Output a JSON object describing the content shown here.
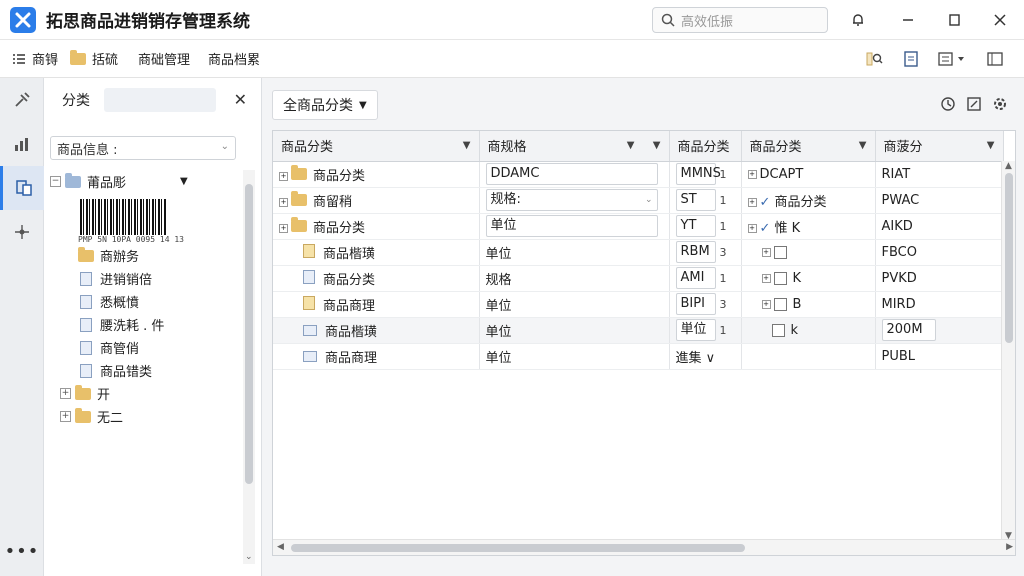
{
  "app": {
    "title": "拓思商品进销销存管理系统"
  },
  "search": {
    "placeholder": "高效低振"
  },
  "menu": {
    "items": [
      "商锝",
      "括硫",
      "商础管理",
      "商品档累"
    ]
  },
  "category_panel": {
    "title": "分类",
    "select_value": "商品信息 :",
    "tree": [
      {
        "label": "莆品彫",
        "level": 0
      },
      {
        "label": "商辦务",
        "level": 1
      },
      {
        "label": "进销销倍",
        "level": 1
      },
      {
        "label": "悉概憤",
        "level": 1
      },
      {
        "label": "腰洗耗 . 件",
        "level": 1
      },
      {
        "label": "商管俏",
        "level": 1
      },
      {
        "label": "商品错类",
        "level": 1
      },
      {
        "label": "开",
        "level": 0
      },
      {
        "label": "无二",
        "level": 0
      }
    ],
    "barcode_text": "PMP 5N 10PA 0095 14 13"
  },
  "main": {
    "tab_label": "全商品分类",
    "columns": [
      "商品分类",
      "商规格",
      "商品分类",
      "商品分类",
      "商菠分"
    ],
    "rows": [
      {
        "c1": "商品分类",
        "c2": "DDAMC",
        "c3": "MMNS",
        "c3n": "1",
        "c4": "DCAPT",
        "c5": "RIAT"
      },
      {
        "c1": "商留稍",
        "c2": "规格:",
        "c3": "ST",
        "c3n": "1",
        "c4": "商品分类",
        "c5": "PWAC"
      },
      {
        "c1": "商品分类",
        "c2": "单位",
        "c3": "YT",
        "c3n": "1",
        "c4": "惟 K",
        "c5": "AIKD"
      },
      {
        "c1": "商品楷璜",
        "c2": "单位",
        "c3": "RBM",
        "c3n": "3",
        "c4": "",
        "c5": "FBCO"
      },
      {
        "c1": "商品分类",
        "c2": "规格",
        "c3": "AMI",
        "c3n": "1",
        "c4": "K",
        "c5": "PVKD"
      },
      {
        "c1": "商品商理",
        "c2": "单位",
        "c3": "BIPI",
        "c3n": "3",
        "c4": "B",
        "c5": "MIRD"
      },
      {
        "c1": "商品楷璜",
        "c2": "单位",
        "c3": "単位",
        "c3n": "1",
        "c4": "k",
        "c5": "200M"
      },
      {
        "c1": "商品商理",
        "c2": "单位",
        "c3": "進集 ∨",
        "c3n": "",
        "c4": "",
        "c5": "PUBL"
      }
    ]
  }
}
